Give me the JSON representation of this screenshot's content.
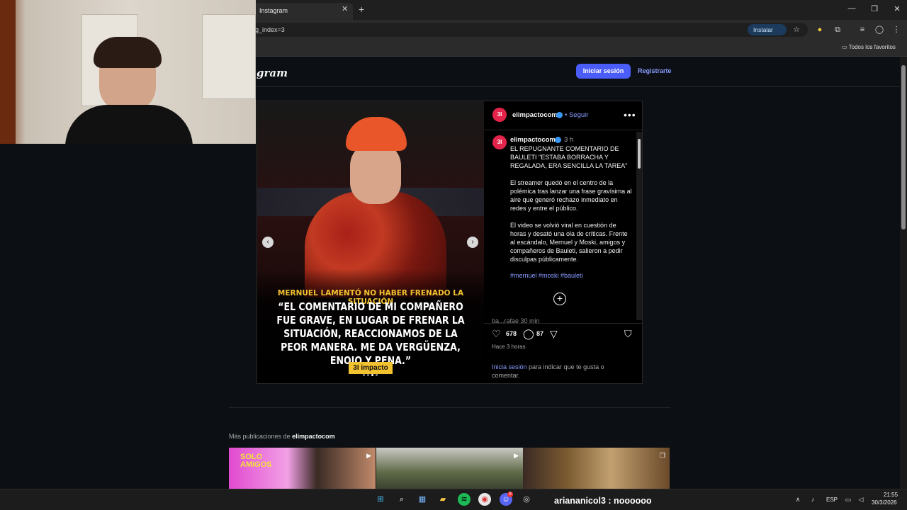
{
  "browser": {
    "tab_title": "Instagram",
    "tab_close": "✕",
    "new_tab": "+",
    "url": "g_index=3",
    "install_label": "Instalar",
    "bookmarks_folder": "Todos los favoritos"
  },
  "header": {
    "logo_text": "gram",
    "login_label": "Iniciar sesión",
    "signup_label": "Registrarte"
  },
  "post": {
    "account": "elimpactocom",
    "follow_label": "• Seguir",
    "avatar_text": "3I",
    "more_label": "•••",
    "image": {
      "subtitle": "MERNUEL LAMENTÓ NO HABER FRENADO LA SITUACIÓN",
      "quote": "“EL COMENTARIO DE MI COMPAÑERO FUE GRAVE, EN LUGAR DE FRENAR LA SITUACIÓN, REACCIONAMOS DE LA PEOR MANERA. ME DA VERGÜENZA, ENOJO Y PENA.”",
      "brand": "3I impacto"
    },
    "caption": {
      "author": "elimpactocom",
      "time": "3 h",
      "headline": "EL REPUGNANTE COMENTARIO DE BAULETI \"ESTABA BORRACHA Y REGALADA, ERA SENCILLA LA TAREA\"",
      "paragraph1": "El streamer quedó en el centro de la polémica tras lanzar una frase gravísima al aire que generó rechazo inmediato en redes y entre el público.",
      "paragraph2": "El video se volvió viral en cuestión de horas y desató una ola de críticas. Frente al escándalo, Mernuel y Moski, amigos y compañeros de Bauleti, salieron a pedir disculpas públicamente.",
      "hashtags": "#mernuel #moski #bauleti",
      "load_more": "+",
      "comment_peek": "ba...rafae 30 min"
    },
    "likes": "678",
    "comments": "87",
    "posted": "Hace 3 horas",
    "login_prompt_link": "Inicia sesión",
    "login_prompt_rest": " para indicar que te gusta o comentar."
  },
  "more_posts": {
    "prefix": "Más publicaciones de ",
    "account": "elimpactocom",
    "thumb1_text": "SOLO AMIGOS"
  },
  "taskbar": {
    "overlay_chat": "ariananicol3 : noooooo",
    "discord_badge": "9",
    "lang": "ESP",
    "time": "21:55",
    "date": "30/3/2026"
  },
  "colors": {
    "accent": "#4a5df9",
    "link": "#8a9bff",
    "brand_red": "#e3244a",
    "brand_yellow": "#f2c230"
  }
}
